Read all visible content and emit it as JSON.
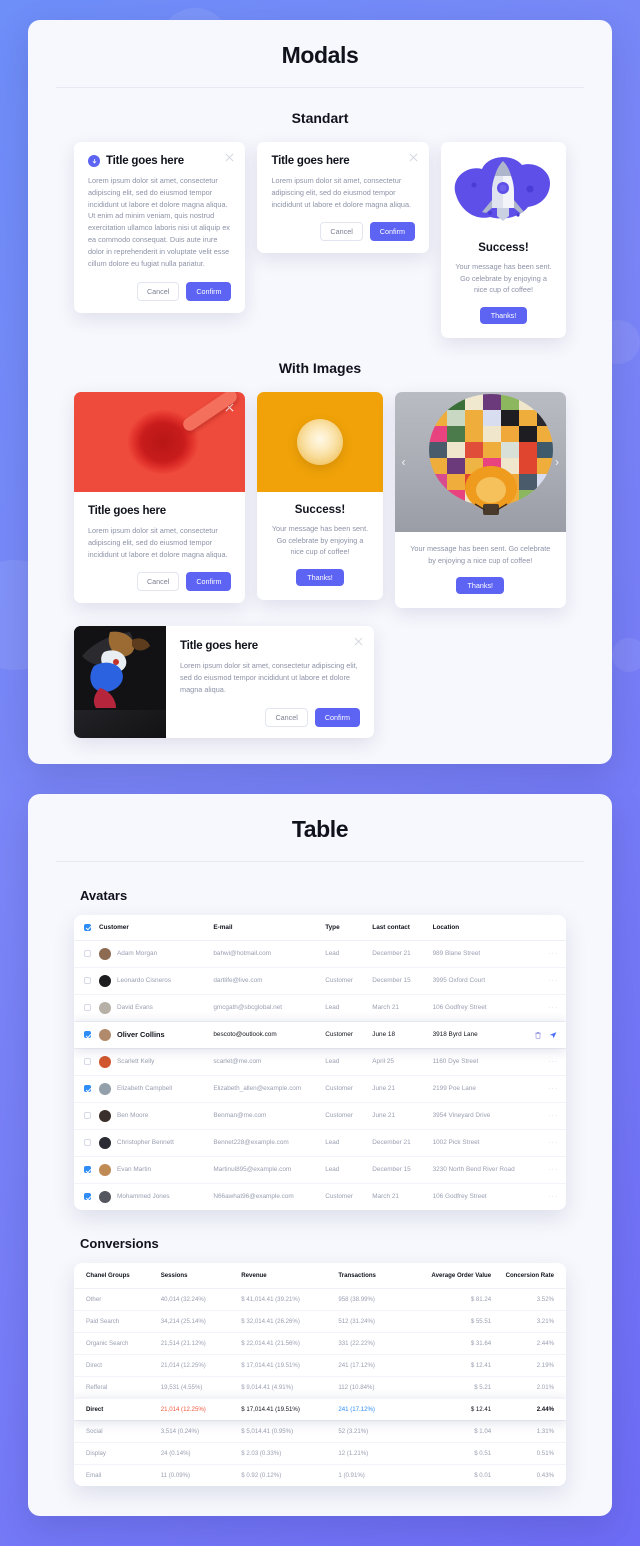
{
  "theme": {
    "accent": "#5d63f2",
    "checkbox_blue": "#2e8cf7",
    "highlight_red": "#f0563e",
    "bg_from": "#6e8ef8",
    "bg_to": "#6e6cf6"
  },
  "modals_panel": {
    "title": "Modals",
    "sections": {
      "standart": "Standart",
      "with_images": "With Images"
    },
    "standart": {
      "card1": {
        "icon": "arrow-down-circle-icon",
        "title": "Title goes here",
        "body": "Lorem ipsum dolor sit amet, consectetur adipiscing elit, sed do eiusmod tempor incididunt ut labore et dolore magna aliqua. Ut enim ad minim veniam, quis nostrud exercitation ullamco laboris nisi ut aliquip ex ea commodo consequat. Duis aute irure dolor in reprehenderit in voluptate velit esse cillum dolore eu fugiat nulla pariatur.",
        "cancel": "Cancel",
        "confirm": "Confirm",
        "close": "close-icon"
      },
      "card2": {
        "title": "Title goes here",
        "body": "Lorem ipsum dolor sit amet, consectetur adipiscing elit, sed do eiusmod tempor incididunt ut labore et dolore magna aliqua.",
        "cancel": "Cancel",
        "confirm": "Confirm",
        "close": "close-icon"
      },
      "card3": {
        "art": "rocket-illustration",
        "heading": "Success!",
        "body": "Your message has been sent. Go celebrate by enjoying a nice cup of coffee!",
        "thanks": "Thanks!"
      }
    },
    "with_images": {
      "card1": {
        "image": "red-drink-photo",
        "title": "Title goes here",
        "body": "Lorem ipsum dolor sit amet, consectetur adipiscing elit, sed do eiusmod tempor incididunt ut labore et dolore magna aliqua.",
        "cancel": "Cancel",
        "confirm": "Confirm",
        "close": "close-icon"
      },
      "card2": {
        "image": "orange-fruit-photo",
        "heading": "Success!",
        "body": "Your message has been sent. Go celebrate by enjoying a nice cup of coffee!",
        "thanks": "Thanks!"
      },
      "card3": {
        "image": "hot-air-balloon-photo",
        "prev": "‹",
        "next": "›",
        "body": "Your message has been sent. Go celebrate by enjoying a nice cup of coffee!",
        "thanks": "Thanks!"
      },
      "card4": {
        "image": "cassowary-bird-photo",
        "title": "Title goes here",
        "body": "Lorem ipsum dolor sit amet, consectetur adipiscing elit, sed do eiusmod tempor incididunt ut labore et dolore magna aliqua.",
        "cancel": "Cancel",
        "confirm": "Confirm",
        "close": "close-icon"
      }
    }
  },
  "table_panel": {
    "title": "Table",
    "avatars": {
      "heading": "Avatars",
      "columns": [
        "Customer",
        "E-mail",
        "Type",
        "Last contact",
        "Location"
      ],
      "header_checked": true,
      "rows": [
        {
          "checked": false,
          "name": "Adam Morgan",
          "email": "bahwi@hotmail.com",
          "type": "Lead",
          "last_contact": "December 21",
          "location": "989 Blane Street",
          "avatar_color": "#8d6b52"
        },
        {
          "checked": false,
          "name": "Leonardo Cisneros",
          "email": "dartlife@live.com",
          "type": "Customer",
          "last_contact": "December 15",
          "location": "3995 Oxford Court",
          "avatar_color": "#1d1d20"
        },
        {
          "checked": false,
          "name": "David Evans",
          "email": "gmcgath@sbcglobal.net",
          "type": "Lead",
          "last_contact": "March 21",
          "location": "106 Godfrey Street",
          "avatar_color": "#b7b0a6"
        },
        {
          "checked": true,
          "name": "Oliver Collins",
          "email": "bescoto@outlook.com",
          "type": "Customer",
          "last_contact": "June 18",
          "location": "3918 Byrd Lane",
          "avatar_color": "#b08a6a",
          "highlighted": true,
          "actions": [
            "trash-icon",
            "send-icon"
          ]
        },
        {
          "checked": false,
          "name": "Scarlett Kelly",
          "email": "scarlet@me.com",
          "type": "Lead",
          "last_contact": "April 25",
          "location": "1160 Dye Street",
          "avatar_color": "#d0572e"
        },
        {
          "checked": true,
          "name": "Elizabeth Campbell",
          "email": "Elizabeth_allen@example.com",
          "type": "Customer",
          "last_contact": "June 21",
          "location": "2199 Poe Lane",
          "avatar_color": "#93a0ab"
        },
        {
          "checked": false,
          "name": "Ben Moore",
          "email": "Benman@me.com",
          "type": "Customer",
          "last_contact": "June 21",
          "location": "3954 Vineyard Drive",
          "avatar_color": "#3a2f2a"
        },
        {
          "checked": false,
          "name": "Christopher Bennett",
          "email": "Bennet228@example.com",
          "type": "Lead",
          "last_contact": "December 21",
          "location": "1002 Pick Street",
          "avatar_color": "#2b2b33"
        },
        {
          "checked": true,
          "name": "Evan Martin",
          "email": "Martinul895@example.com",
          "type": "Lead",
          "last_contact": "December 15",
          "location": "3230 North Bend River Road",
          "avatar_color": "#c08a55"
        },
        {
          "checked": true,
          "name": "Mohammed Jones",
          "email": "N66awhat96@example.com",
          "type": "Customer",
          "last_contact": "March 21",
          "location": "106 Godfrey Street",
          "avatar_color": "#55575e"
        }
      ]
    },
    "conversions": {
      "heading": "Conversions",
      "columns": [
        "Chanel Groups",
        "Sessions",
        "Revenue",
        "Transactions",
        "Average Order Value",
        "Concersion Rate"
      ],
      "rows": [
        {
          "group": "Other",
          "sessions": "40,014 (32.24%)",
          "revenue": "$ 41,014.41 (39.21%)",
          "transactions": "958 (38.99%)",
          "aov": "$ 81.24",
          "rate": "3.52%"
        },
        {
          "group": "Paid Search",
          "sessions": "34,214 (25.14%)",
          "revenue": "$ 32,014.41 (26.26%)",
          "transactions": "512 (31.24%)",
          "aov": "$ 55.51",
          "rate": "3.21%"
        },
        {
          "group": "Organic Search",
          "sessions": "21,514 (21.12%)",
          "revenue": "$ 22,014.41 (21.56%)",
          "transactions": "331 (22.22%)",
          "aov": "$ 31.64",
          "rate": "2.44%"
        },
        {
          "group": "Direct",
          "sessions": "21,014 (12.25%)",
          "revenue": "$ 17,014.41 (19.51%)",
          "transactions": "241 (17.12%)",
          "aov": "$ 12.41",
          "rate": "2.19%"
        },
        {
          "group": "Refferal",
          "sessions": "19,531 (4.55%)",
          "revenue": "$ 9,014.41 (4.91%)",
          "transactions": "112 (10.84%)",
          "aov": "$ 5.21",
          "rate": "2.01%"
        },
        {
          "group": "Direct",
          "sessions": "21,014 (12.25%)",
          "revenue": "$ 17,014.41 (19.51%)",
          "transactions": "241 (17.12%)",
          "aov": "$ 12.41",
          "rate": "2.44%",
          "highlighted": true
        },
        {
          "group": "Social",
          "sessions": "3,514 (0.24%)",
          "revenue": "$ 5,014.41 (0.95%)",
          "transactions": "52 (3.21%)",
          "aov": "$ 1.04",
          "rate": "1.31%"
        },
        {
          "group": "Display",
          "sessions": "24 (0.14%)",
          "revenue": "$ 2.03 (0.33%)",
          "transactions": "12 (1.21%)",
          "aov": "$ 0.51",
          "rate": "0.51%"
        },
        {
          "group": "Email",
          "sessions": "11 (0.09%)",
          "revenue": "$ 0.92 (0.12%)",
          "transactions": "1 (0.91%)",
          "aov": "$ 0.01",
          "rate": "0.43%"
        }
      ]
    }
  }
}
